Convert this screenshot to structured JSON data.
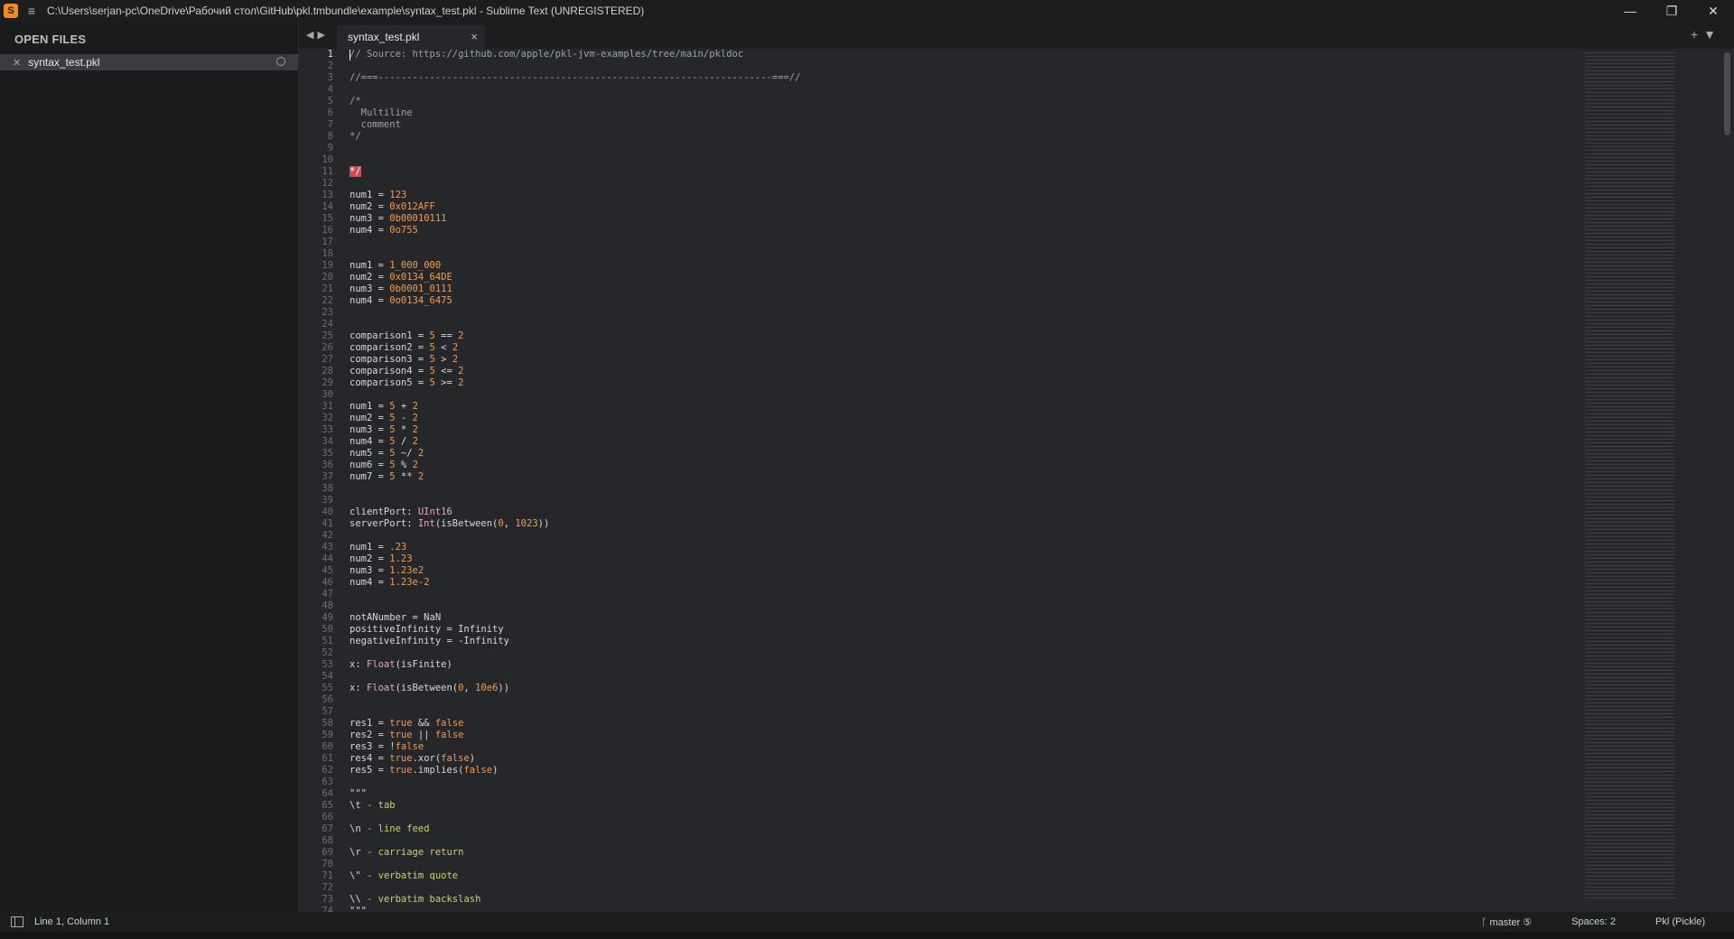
{
  "window": {
    "title": "C:\\Users\\serjan-pc\\OneDrive\\Рабочий стол\\GitHub\\pkl.tmbundle\\example\\syntax_test.pkl - Sublime Text (UNREGISTERED)",
    "app_icon_glyph": "S",
    "minimize": "—",
    "maximize": "❐",
    "close": "✕"
  },
  "sidebar": {
    "header": "OPEN FILES",
    "files": [
      {
        "name": "syntax_test.pkl"
      }
    ]
  },
  "tabs": {
    "nav": "◀▶",
    "active": {
      "label": "syntax_test.pkl",
      "close": "×"
    },
    "right_controls": "+▼"
  },
  "editor": {
    "lines": [
      [
        [
          "// Source: https://github.com/apple/pkl-jvm-examples/tree/main/pkldoc",
          "com"
        ]
      ],
      [],
      [
        [
          "//===---------------------------------------------------------------------===//",
          "com"
        ]
      ],
      [],
      [
        [
          "/*",
          "com"
        ]
      ],
      [
        [
          "  Multiline",
          "com"
        ]
      ],
      [
        [
          "  comment",
          "com"
        ]
      ],
      [
        [
          "*/",
          "com"
        ]
      ],
      [],
      [],
      [
        [
          "*/",
          "err"
        ]
      ],
      [],
      [
        [
          "num1 = ",
          "id"
        ],
        [
          "123",
          "num"
        ]
      ],
      [
        [
          "num2 = ",
          "id"
        ],
        [
          "0x012AFF",
          "num"
        ]
      ],
      [
        [
          "num3 = ",
          "id"
        ],
        [
          "0b00010111",
          "num"
        ]
      ],
      [
        [
          "num4 = ",
          "id"
        ],
        [
          "0o755",
          "num"
        ]
      ],
      [],
      [],
      [
        [
          "num1 = ",
          "id"
        ],
        [
          "1_000_000",
          "num"
        ]
      ],
      [
        [
          "num2 = ",
          "id"
        ],
        [
          "0x0134_64DE",
          "num"
        ]
      ],
      [
        [
          "num3 = ",
          "id"
        ],
        [
          "0b0001_0111",
          "num"
        ]
      ],
      [
        [
          "num4 = ",
          "id"
        ],
        [
          "0o0134_6475",
          "num"
        ]
      ],
      [],
      [],
      [
        [
          "comparison1 = ",
          "id"
        ],
        [
          "5",
          "num"
        ],
        [
          " == ",
          "op"
        ],
        [
          "2",
          "num"
        ]
      ],
      [
        [
          "comparison2 = ",
          "id"
        ],
        [
          "5",
          "num"
        ],
        [
          " < ",
          "op"
        ],
        [
          "2",
          "num"
        ]
      ],
      [
        [
          "comparison3 = ",
          "id"
        ],
        [
          "5",
          "num"
        ],
        [
          " > ",
          "op"
        ],
        [
          "2",
          "num"
        ]
      ],
      [
        [
          "comparison4 = ",
          "id"
        ],
        [
          "5",
          "num"
        ],
        [
          " <= ",
          "op"
        ],
        [
          "2",
          "num"
        ]
      ],
      [
        [
          "comparison5 = ",
          "id"
        ],
        [
          "5",
          "num"
        ],
        [
          " >= ",
          "op"
        ],
        [
          "2",
          "num"
        ]
      ],
      [],
      [
        [
          "num1 = ",
          "id"
        ],
        [
          "5",
          "num"
        ],
        [
          " + ",
          "op"
        ],
        [
          "2",
          "num"
        ]
      ],
      [
        [
          "num2 = ",
          "id"
        ],
        [
          "5",
          "num"
        ],
        [
          " - ",
          "op"
        ],
        [
          "2",
          "num"
        ]
      ],
      [
        [
          "num3 = ",
          "id"
        ],
        [
          "5",
          "num"
        ],
        [
          " * ",
          "op"
        ],
        [
          "2",
          "num"
        ]
      ],
      [
        [
          "num4 = ",
          "id"
        ],
        [
          "5",
          "num"
        ],
        [
          " / ",
          "op"
        ],
        [
          "2",
          "num"
        ]
      ],
      [
        [
          "num5 = ",
          "id"
        ],
        [
          "5",
          "num"
        ],
        [
          " ~/ ",
          "op"
        ],
        [
          "2",
          "num"
        ]
      ],
      [
        [
          "num6 = ",
          "id"
        ],
        [
          "5",
          "num"
        ],
        [
          " % ",
          "op"
        ],
        [
          "2",
          "num"
        ]
      ],
      [
        [
          "num7 = ",
          "id"
        ],
        [
          "5",
          "num"
        ],
        [
          " ** ",
          "op"
        ],
        [
          "2",
          "num"
        ]
      ],
      [],
      [],
      [
        [
          "clientPort: ",
          "id"
        ],
        [
          "UInt16",
          "type"
        ]
      ],
      [
        [
          "serverPort: ",
          "id"
        ],
        [
          "Int",
          "type"
        ],
        [
          "(isBetween(",
          "id"
        ],
        [
          "0",
          "num"
        ],
        [
          ", ",
          "op"
        ],
        [
          "1023",
          "num"
        ],
        [
          "))",
          "id"
        ]
      ],
      [],
      [
        [
          "num1 = ",
          "id"
        ],
        [
          ".23",
          "num"
        ]
      ],
      [
        [
          "num2 = ",
          "id"
        ],
        [
          "1.23",
          "num"
        ]
      ],
      [
        [
          "num3 = ",
          "id"
        ],
        [
          "1.23e2",
          "num"
        ]
      ],
      [
        [
          "num4 = ",
          "id"
        ],
        [
          "1.23e-2",
          "num"
        ]
      ],
      [],
      [],
      [
        [
          "notANumber = NaN",
          "id"
        ]
      ],
      [
        [
          "positiveInfinity = Infinity",
          "id"
        ]
      ],
      [
        [
          "negativeInfinity = -Infinity",
          "id"
        ]
      ],
      [],
      [
        [
          "x: ",
          "id"
        ],
        [
          "Float",
          "type"
        ],
        [
          "(isFinite)",
          "id"
        ]
      ],
      [],
      [
        [
          "x: ",
          "id"
        ],
        [
          "Float",
          "type"
        ],
        [
          "(isBetween(",
          "id"
        ],
        [
          "0",
          "num"
        ],
        [
          ", ",
          "op"
        ],
        [
          "10e6",
          "num"
        ],
        [
          "))",
          "id"
        ]
      ],
      [],
      [],
      [
        [
          "res1 = ",
          "id"
        ],
        [
          "true",
          "kw"
        ],
        [
          " && ",
          "op"
        ],
        [
          "false",
          "kw"
        ]
      ],
      [
        [
          "res2 = ",
          "id"
        ],
        [
          "true",
          "kw"
        ],
        [
          " || ",
          "op"
        ],
        [
          "false",
          "kw"
        ]
      ],
      [
        [
          "res3 = !",
          "id"
        ],
        [
          "false",
          "kw"
        ]
      ],
      [
        [
          "res4 = ",
          "id"
        ],
        [
          "true",
          "kw"
        ],
        [
          ".xor(",
          "id"
        ],
        [
          "false",
          "kw"
        ],
        [
          ")",
          "id"
        ]
      ],
      [
        [
          "res5 = ",
          "id"
        ],
        [
          "true",
          "kw"
        ],
        [
          ".implies(",
          "id"
        ],
        [
          "false",
          "kw"
        ],
        [
          ")",
          "id"
        ]
      ],
      [],
      [
        [
          "\"\"\"",
          "id"
        ]
      ],
      [
        [
          "\\t",
          "id"
        ],
        [
          " - tab",
          "str"
        ]
      ],
      [],
      [
        [
          "\\n",
          "id"
        ],
        [
          " - line feed",
          "str"
        ]
      ],
      [],
      [
        [
          "\\r",
          "id"
        ],
        [
          " - carriage return",
          "str"
        ]
      ],
      [],
      [
        [
          "\\\"",
          "id"
        ],
        [
          " - verbatim quote",
          "str"
        ]
      ],
      [],
      [
        [
          "\\\\",
          "id"
        ],
        [
          " - verbatim backslash",
          "str"
        ]
      ],
      [
        [
          "\"\"\"",
          "id"
        ]
      ]
    ]
  },
  "statusbar": {
    "position": "Line 1, Column 1",
    "branch": "ᚴ master ⑤",
    "indent": "Spaces: 2",
    "syntax": "Pkl (Pickle)"
  }
}
